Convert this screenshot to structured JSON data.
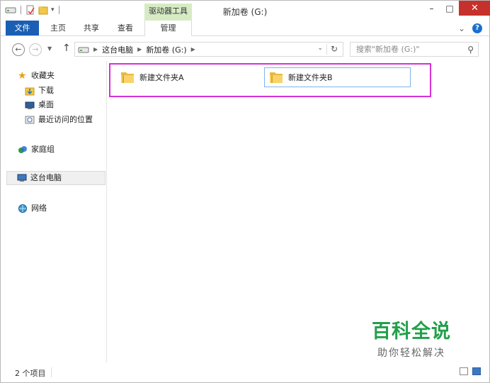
{
  "window": {
    "title": "新加卷 (G:)",
    "context_tab": "驱动器工具",
    "minimize": "–",
    "maximize": "□",
    "close": "✕"
  },
  "ribbon": {
    "tabs": [
      "文件",
      "主页",
      "共享",
      "查看",
      "管理"
    ],
    "collapse": "⌄",
    "help": "?"
  },
  "address": {
    "segments": [
      "这台电脑",
      "新加卷 (G:)"
    ],
    "search_placeholder": "搜索\"新加卷 (G:)\""
  },
  "nav": {
    "favorites": "收藏夹",
    "downloads": "下载",
    "desktop": "桌面",
    "recent": "最近访问的位置",
    "homegroup": "家庭组",
    "this_pc": "这台电脑",
    "network": "网络"
  },
  "files": [
    {
      "name": "新建文件夹A"
    },
    {
      "name": "新建文件夹B"
    }
  ],
  "status": {
    "count": "2 个项目"
  },
  "watermark": {
    "line1": "百科全说",
    "line2": "助你轻松解决"
  },
  "colors": {
    "file_tab": "#1a5fb4",
    "context_tab": "#d6ebc4",
    "close": "#c7312b",
    "highlight": "#d631d6",
    "watermark": "#22a04a"
  }
}
